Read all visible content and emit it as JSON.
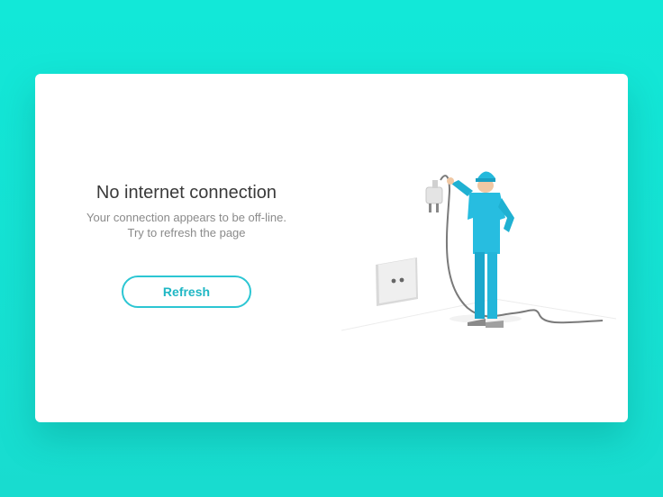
{
  "error": {
    "title": "No internet connection",
    "message_line1": "Your connection appears to be off-line.",
    "message_line2": "Try to refresh the page"
  },
  "actions": {
    "refresh_label": "Refresh"
  },
  "colors": {
    "background": "#14e4d6",
    "accent": "#2cc6d3",
    "figure": "#22b5d6"
  },
  "illustration": {
    "icons": [
      "wall-socket-icon",
      "plug-icon",
      "cable-icon",
      "technician-figure"
    ]
  }
}
